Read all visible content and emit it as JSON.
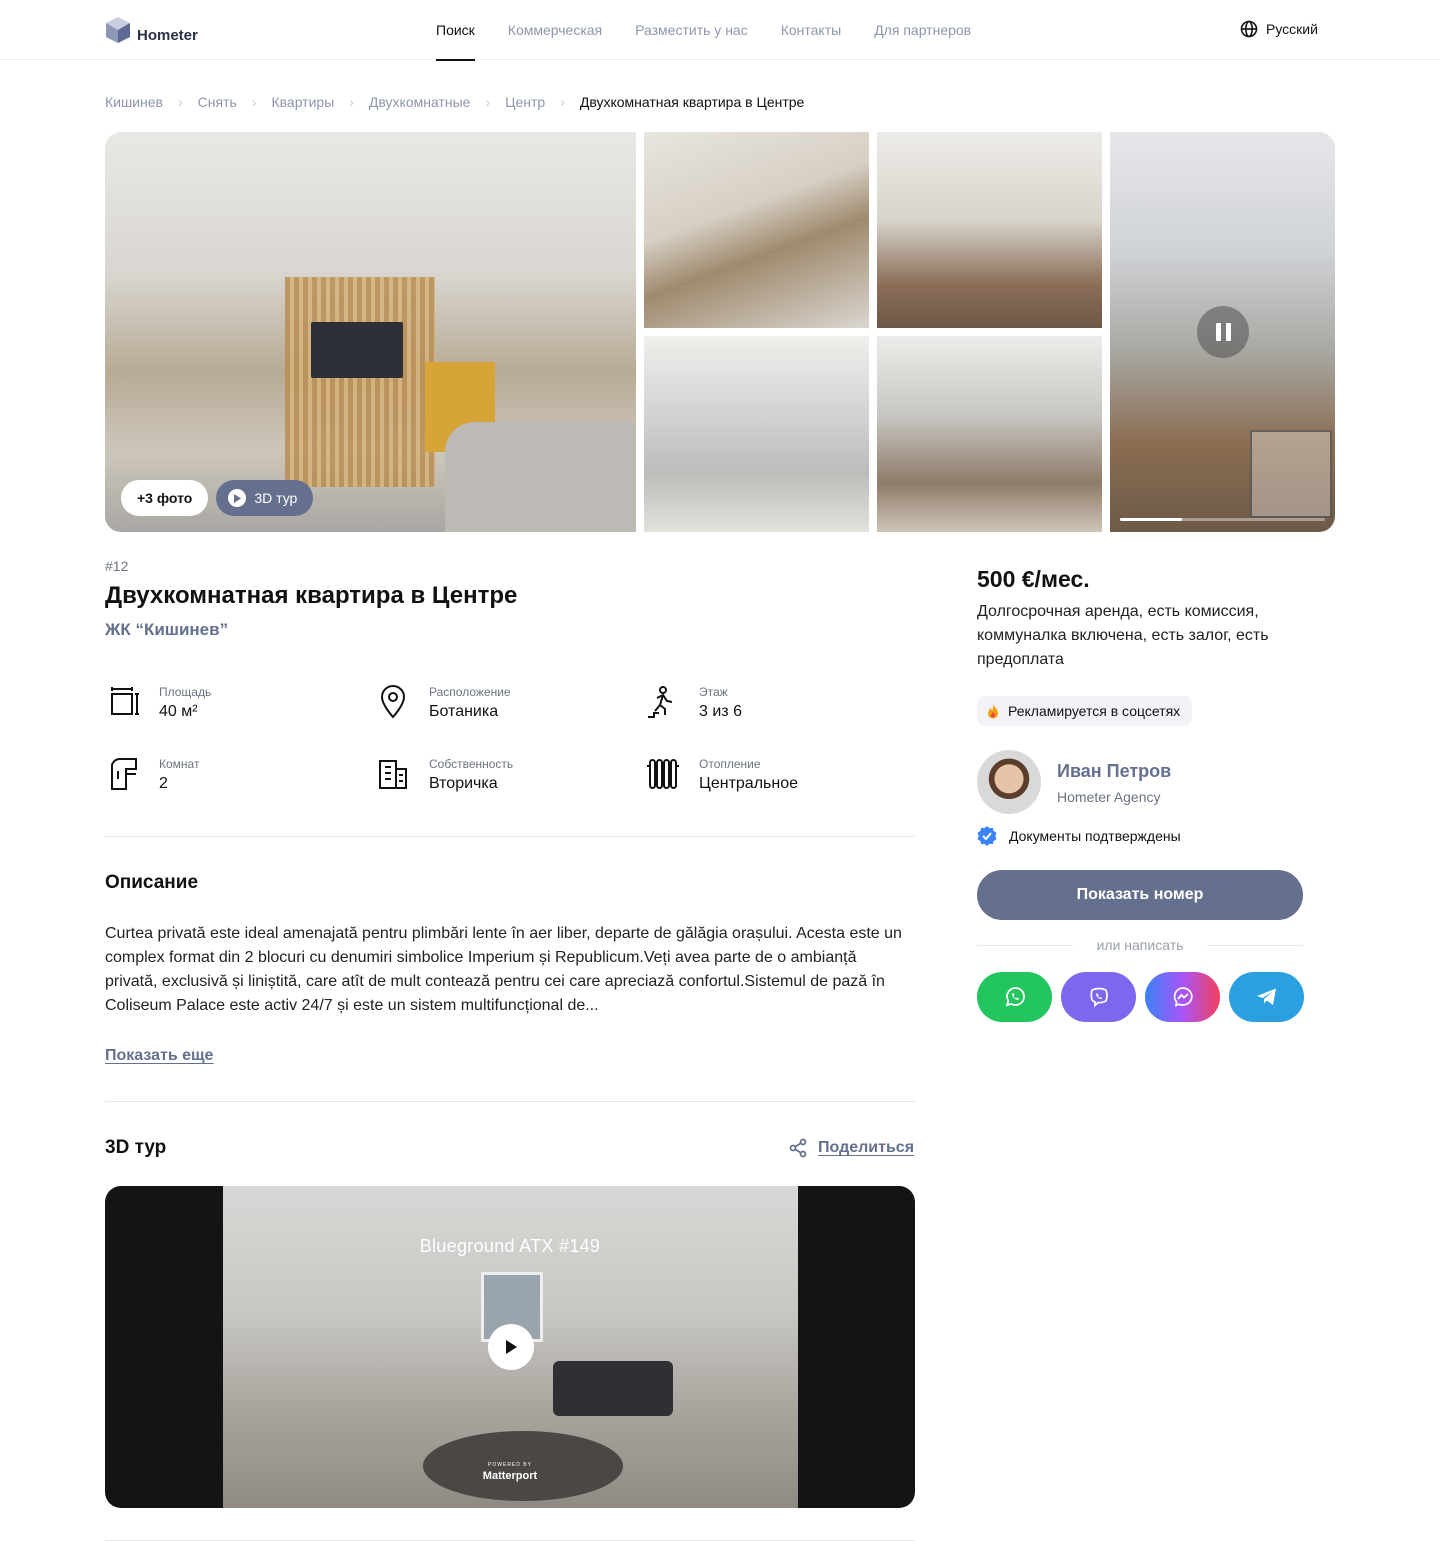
{
  "header": {
    "logo_text": "Hometer",
    "nav": [
      {
        "label": "Поиск",
        "active": true
      },
      {
        "label": "Коммерческая",
        "active": false
      },
      {
        "label": "Разместить у нас",
        "active": false
      },
      {
        "label": "Контакты",
        "active": false
      },
      {
        "label": "Для партнеров",
        "active": false
      }
    ],
    "language": "Русский"
  },
  "breadcrumbs": [
    "Кишинев",
    "Снять",
    "Квартиры",
    "Двухкомнатные",
    "Центр",
    "Двухкомнатная квартира в Центре"
  ],
  "gallery": {
    "more_photos": "+3 фото",
    "tour_button": "3D тур",
    "video_progress": 0.3
  },
  "listing": {
    "id": "#12",
    "title": "Двухкомнатная квартира в Центре",
    "complex": "ЖК “Кишинев”",
    "features": [
      {
        "icon": "area-icon",
        "label": "Площадь",
        "value": "40 м²"
      },
      {
        "icon": "location-pin-icon",
        "label": "Расположение",
        "value": "Ботаника"
      },
      {
        "icon": "stairs-walking-icon",
        "label": "Этаж",
        "value": "3 из 6"
      },
      {
        "icon": "door-icon",
        "label": "Комнат",
        "value": "2"
      },
      {
        "icon": "building-icon",
        "label": "Собственность",
        "value": "Вторичка"
      },
      {
        "icon": "radiator-icon",
        "label": "Отопление",
        "value": "Центральное"
      }
    ]
  },
  "description": {
    "title": "Описание",
    "text": "Curtea privată este ideal amenajată pentru plimbări lente în aer liber, departe de gălăgia orașului. Acesta este un complex format din 2 blocuri cu denumiri simbolice Imperium și Republicum.Veți avea parte de o ambianță privată, exclusivă și liniștită, care atît de mult contează pentru cei care apreciază confortul.Sistemul de pază în Coliseum Palace este activ 24/7 și este un sistem multifuncțional de...",
    "show_more": "Показать еще"
  },
  "tour": {
    "title": "3D тур",
    "share": "Поделиться",
    "video_title": "Blueground ATX #149",
    "powered_by": "POWERED BY",
    "brand": "Matterport"
  },
  "sidebar": {
    "price": "500 €/мес.",
    "terms": "Долгосрочная аренда, есть комиссия, коммуналка включена, есть залог, есть предоплата",
    "promo": "Рекламируется в соцсетях",
    "agent_name": "Иван Петров",
    "agent_agency": "Hometer Agency",
    "verified": "Документы подтверждены",
    "show_number": "Показать номер",
    "or_write": "или написать",
    "messengers": [
      "whatsapp-icon",
      "viber-icon",
      "messenger-icon",
      "telegram-icon"
    ]
  },
  "colors": {
    "accent": "#65708f",
    "muted": "#8d96ad",
    "whatsapp": "#22c55e",
    "viber": "#7b68ee",
    "telegram": "#2ba0e0"
  }
}
